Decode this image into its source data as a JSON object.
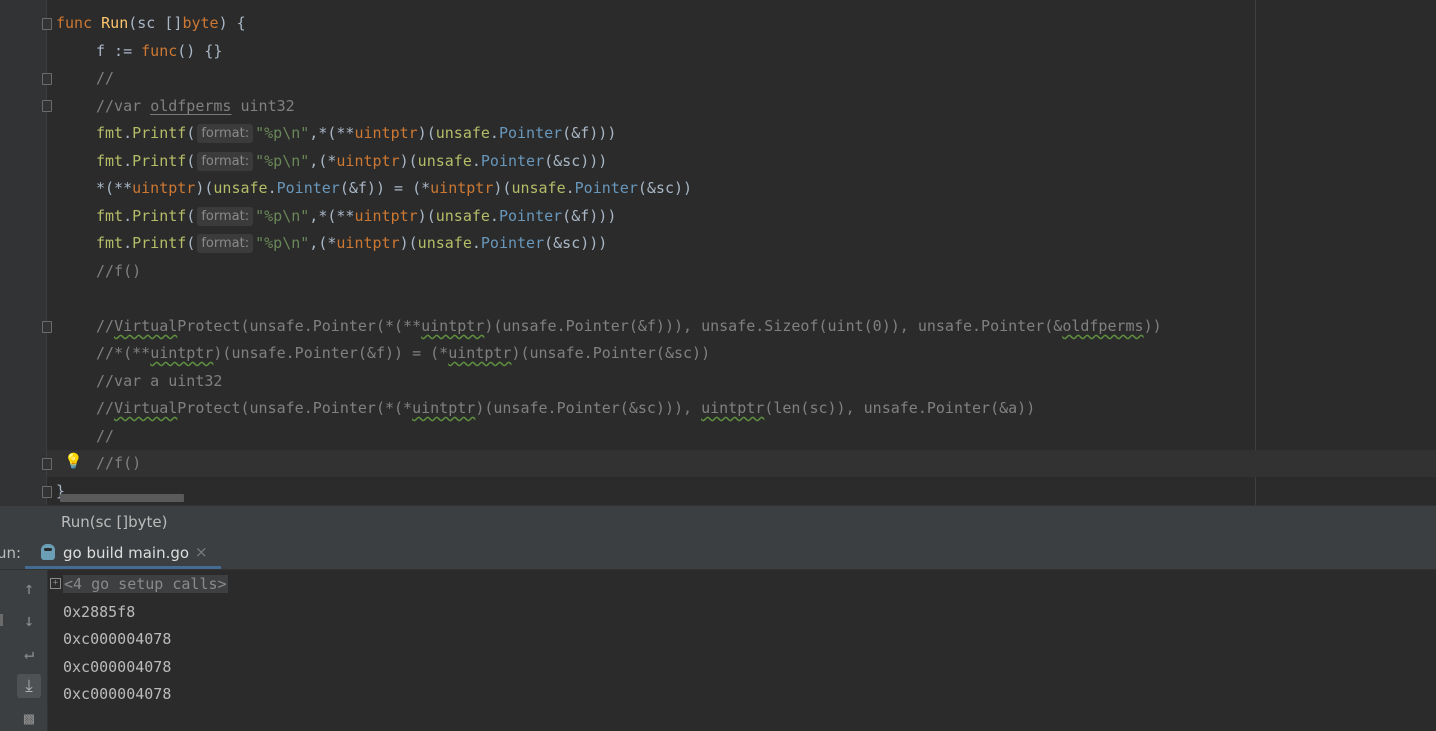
{
  "editor": {
    "lines": [
      "func Run(sc []byte) {",
      "f := func() {}",
      "//",
      "//var oldfperms uint32",
      "fmt.Printf( format: \"%p\\n\",*(**uintptr)(unsafe.Pointer(&f)))",
      "fmt.Printf( format: \"%p\\n\",(*uintptr)(unsafe.Pointer(&sc)))",
      "*(**uintptr)(unsafe.Pointer(&f)) = (*uintptr)(unsafe.Pointer(&sc))",
      "fmt.Printf( format: \"%p\\n\",*(**uintptr)(unsafe.Pointer(&f)))",
      "fmt.Printf( format: \"%p\\n\",(*uintptr)(unsafe.Pointer(&sc)))",
      "//f()",
      "",
      "//VirtualProtect(unsafe.Pointer(*(**uintptr)(unsafe.Pointer(&f))), unsafe.Sizeof(uint(0)), unsafe.Pointer(&oldfperms))",
      "//*(**uintptr)(unsafe.Pointer(&f)) = (*uintptr)(unsafe.Pointer(&sc))",
      "//var a uint32",
      "//VirtualProtect(unsafe.Pointer(*(*uintptr)(unsafe.Pointer(&sc))), uintptr(len(sc)), unsafe.Pointer(&a))",
      "//",
      "//f()",
      "}"
    ],
    "param_hint": "format:"
  },
  "breadcrumb": "Run(sc []byte)",
  "run_panel": {
    "label": "un:",
    "tab_label": "go build main.go",
    "close_glyph": "×",
    "setup_calls": "<4 go setup calls>",
    "output": [
      "0x2885f8",
      "0xc000004078",
      "0xc000004078",
      "0xc000004078"
    ]
  },
  "icons": {
    "bulb": "lightbulb-icon",
    "up": "arrow-up-icon",
    "down": "arrow-down-icon",
    "wrap": "soft-wrap-icon",
    "scroll": "scroll-to-end-icon",
    "print": "print-icon",
    "tab": "go-gopher-icon"
  },
  "colors": {
    "keyword": "#cc7832",
    "function": "#ffc66d",
    "string": "#6a8759",
    "type_name": "#6897bb",
    "comment": "#808080",
    "background": "#2b2b2b"
  }
}
